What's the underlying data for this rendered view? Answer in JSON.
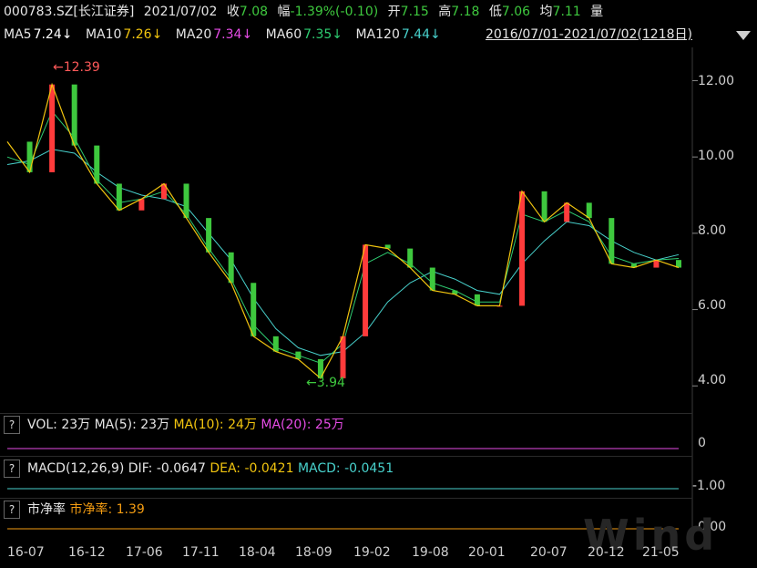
{
  "quote": {
    "code": "000783.SZ[长江证券]",
    "date": "2021/07/02",
    "close_label": "收",
    "close": "7.08",
    "change_label": "幅",
    "change": "-1.39%(-0.10)",
    "open_label": "开",
    "open": "7.15",
    "high_label": "高",
    "high": "7.18",
    "low_label": "低",
    "low": "7.06",
    "avg_label": "均",
    "avg": "7.11",
    "vol_label": "量"
  },
  "ma": [
    {
      "label": "MA5",
      "value": "7.24↓"
    },
    {
      "label": "MA10",
      "value": "7.26↓"
    },
    {
      "label": "MA20",
      "value": "7.34↓"
    },
    {
      "label": "MA60",
      "value": "7.35↓"
    },
    {
      "label": "MA120",
      "value": "7.44↓"
    }
  ],
  "range": "2016/07/01-2021/07/02(1218日)",
  "colors": {
    "up": "#ff3b3b",
    "down": "#3ec83e",
    "ma5": "#ffffff",
    "ma10": "#f1c40f",
    "ma20": "#e64ce6",
    "ma60": "#2ecc71",
    "ma120": "#48d1cc",
    "dea": "#f1c40f",
    "macd": "#48d1cc",
    "pb": "#f39c12"
  },
  "icons": {
    "help": "question-icon",
    "dropdown": "triangle-down-icon"
  },
  "vol_panel": {
    "help": "?",
    "vol": "VOL: 23万",
    "ma5": "MA(5): 23万",
    "ma10": "MA(10): 24万",
    "ma20": "MA(20): 25万",
    "axis": "0"
  },
  "macd_panel": {
    "help": "?",
    "title": "MACD(12,26,9)",
    "dif": "DIF: -0.0647",
    "dea": "DEA: -0.0421",
    "macd": "MACD: -0.0451",
    "axis": "-1.00"
  },
  "pb_panel": {
    "help": "?",
    "title": "市净率",
    "pb": "市净率: 1.39",
    "axis": "0.00"
  },
  "watermark": "Wind",
  "chart_data": {
    "type": "line",
    "ylim": [
      3.6,
      12.8
    ],
    "y_ticks": [
      "12.00",
      "10.00",
      "8.00",
      "6.00",
      "4.00"
    ],
    "x_ticks": [
      "16-07",
      "16-12",
      "17-06",
      "17-11",
      "18-04",
      "18-09",
      "19-02",
      "19-08",
      "20-01",
      "20-07",
      "20-12",
      "21-05"
    ],
    "annotations": [
      {
        "label": "←12.39",
        "value": 12.39,
        "x": "2016-11"
      },
      {
        "label": "←3.94",
        "value": 3.94,
        "x": "2018-10"
      }
    ],
    "x": [
      0,
      2,
      4,
      6,
      8,
      10,
      12,
      14,
      16,
      18,
      20,
      22,
      24,
      26,
      28,
      30,
      32,
      34,
      36,
      38,
      40,
      42,
      44,
      46,
      48,
      50,
      52,
      54,
      56,
      58,
      60
    ],
    "x_unit": "months since 2016-07",
    "price": [
      10.4,
      9.6,
      11.9,
      10.3,
      9.3,
      8.6,
      8.9,
      9.3,
      8.4,
      7.5,
      6.7,
      5.3,
      4.9,
      4.7,
      4.2,
      5.3,
      7.7,
      7.6,
      7.1,
      6.5,
      6.4,
      6.1,
      6.1,
      9.1,
      8.3,
      8.8,
      8.4,
      7.2,
      7.1,
      7.3,
      7.1
    ],
    "ma120": [
      9.8,
      9.9,
      10.2,
      10.1,
      9.6,
      9.2,
      9.0,
      8.9,
      8.7,
      8.0,
      7.3,
      6.3,
      5.5,
      5.0,
      4.8,
      4.9,
      5.4,
      6.2,
      6.7,
      7.0,
      6.8,
      6.5,
      6.4,
      7.2,
      7.8,
      8.3,
      8.2,
      7.8,
      7.5,
      7.3,
      7.44
    ],
    "ma20": [
      10.0,
      9.8,
      11.2,
      10.5,
      9.4,
      8.8,
      8.9,
      9.1,
      8.5,
      7.6,
      6.8,
      5.6,
      5.0,
      4.8,
      4.6,
      5.1,
      7.2,
      7.5,
      7.2,
      6.7,
      6.5,
      6.2,
      6.2,
      8.5,
      8.3,
      8.6,
      8.3,
      7.4,
      7.2,
      7.3,
      7.34
    ]
  }
}
